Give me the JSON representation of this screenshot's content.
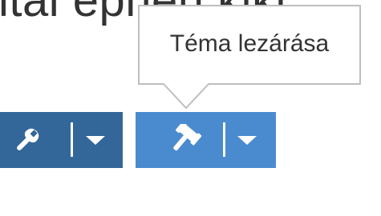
{
  "page": {
    "heading_fragment": "ital ephen kiki"
  },
  "toolbar": {
    "wrench_button": {
      "icon": "wrench-icon",
      "color": "#336699"
    },
    "wrench_dropdown": {
      "icon": "caret-down-icon"
    },
    "gavel_button": {
      "icon": "gavel-icon",
      "color": "#4a8bcf"
    },
    "gavel_dropdown": {
      "icon": "caret-down-icon"
    }
  },
  "tooltip": {
    "text": "Téma lezárása"
  }
}
